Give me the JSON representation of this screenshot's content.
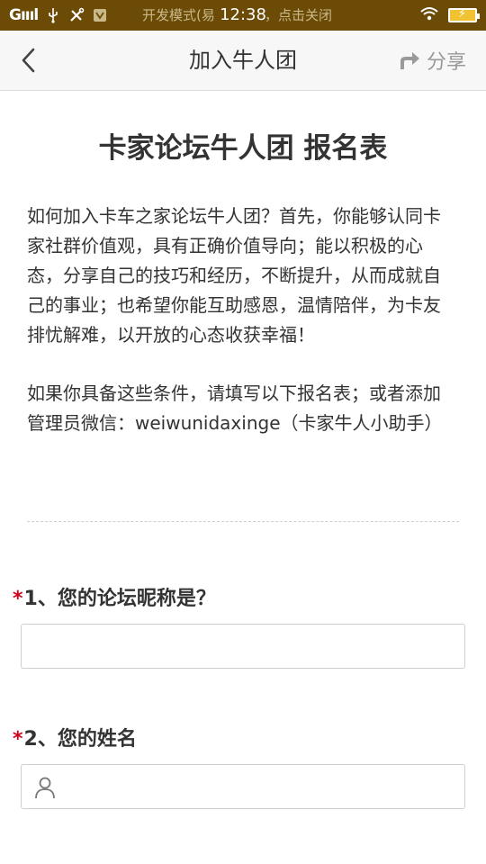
{
  "status_bar": {
    "signal": "Gıııl",
    "dev_mode_text_left": "开发模式(易",
    "time": "12:38",
    "dev_mode_text_right": "，点击关闭"
  },
  "nav": {
    "title": "加入牛人团",
    "share_label": "分享"
  },
  "form": {
    "title": "卡家论坛牛人团 报名表",
    "intro_paragraphs": [
      "如何加入卡车之家论坛牛人团？首先，你能够认同卡家社群价值观，具有正确价值导向；能以积极的心态，分享自己的技巧和经历，不断提升，从而成就自己的事业；也希望你能互助感恩，温情陪伴，为卡友排忧解难，以开放的心态收获幸福！",
      "如果你具备这些条件，请填写以下报名表；或者添加管理员微信：weiwunidaxinge（卡家牛人小助手）"
    ],
    "questions": [
      {
        "required_mark": "*",
        "label": "1、您的论坛昵称是？",
        "value": ""
      },
      {
        "required_mark": "*",
        "label": "2、您的姓名",
        "value": ""
      }
    ]
  },
  "colors": {
    "status_bar_bg": "#6b4b06",
    "required_star": "#d0021b",
    "nav_bg": "#f7f7f7"
  },
  "icons": {
    "back": "chevron-left-icon",
    "share": "share-icon",
    "user": "user-icon",
    "usb": "usb-icon",
    "tools": "tools-icon",
    "wifi": "wifi-icon",
    "battery": "battery-charging-icon"
  }
}
